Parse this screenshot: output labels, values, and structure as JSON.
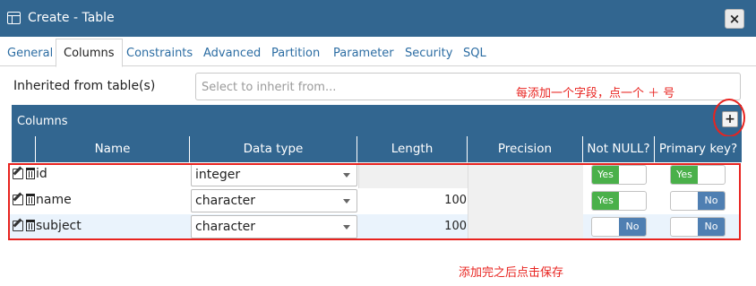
{
  "window": {
    "title": "Create - Table",
    "close_label": "×"
  },
  "tabs": [
    {
      "label": "General"
    },
    {
      "label": "Columns"
    },
    {
      "label": "Constraints"
    },
    {
      "label": "Advanced"
    },
    {
      "label": "Partition"
    },
    {
      "label": "Parameter"
    },
    {
      "label": "Security"
    },
    {
      "label": "SQL"
    }
  ],
  "active_tab": "Columns",
  "inherit": {
    "label": "Inherited from table(s)",
    "placeholder": "Select to inherit from..."
  },
  "columns_panel": {
    "title": "Columns",
    "add_label": "+",
    "headers": [
      "Name",
      "Data type",
      "Length",
      "Precision",
      "Not NULL?",
      "Primary key?"
    ]
  },
  "rows": [
    {
      "name": "id",
      "data_type": "integer",
      "length": "",
      "not_null": "Yes",
      "primary_key": "Yes"
    },
    {
      "name": "name",
      "data_type": "character",
      "length": "100",
      "not_null": "Yes",
      "primary_key": "No"
    },
    {
      "name": "subject",
      "data_type": "character",
      "length": "100",
      "not_null": "No",
      "primary_key": "No"
    }
  ],
  "annotations": {
    "add_hint": "每添加一个字段，点一个 ＋ 号",
    "save_hint": "添加完之后点击保存"
  },
  "colors": {
    "header_blue": "#326690",
    "toggle_yes": "#4ab04a",
    "toggle_no": "#4f7fb2",
    "annotation_red": "#e8231f",
    "link_blue": "#2c6da3"
  }
}
